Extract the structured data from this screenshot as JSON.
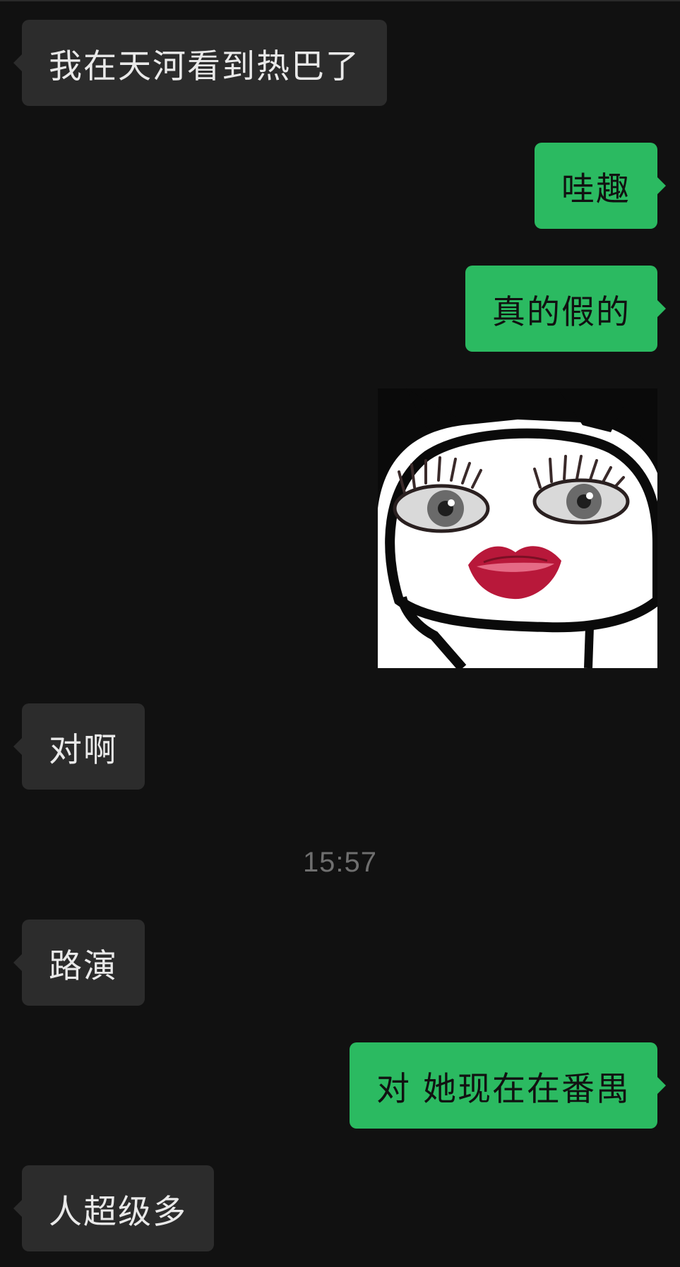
{
  "messages": [
    {
      "direction": "in",
      "text": "我在天河看到热巴了"
    },
    {
      "direction": "out",
      "text": "哇趣"
    },
    {
      "direction": "out",
      "text": "真的假的"
    },
    {
      "direction": "out",
      "type": "sticker",
      "icon": "cartoon-face-sticker"
    },
    {
      "direction": "in",
      "text": "对啊"
    },
    {
      "type": "timestamp",
      "text": "15:57"
    },
    {
      "direction": "in",
      "text": "路演"
    },
    {
      "direction": "out",
      "text": "对 她现在在番禺"
    },
    {
      "direction": "in",
      "text": "人超级多"
    }
  ],
  "colors": {
    "background": "#111111",
    "incoming_bubble": "#2c2c2c",
    "outgoing_bubble": "#2bba61",
    "incoming_text": "#e9e9e9",
    "outgoing_text": "#111111",
    "timestamp_text": "#6f6f6f"
  }
}
